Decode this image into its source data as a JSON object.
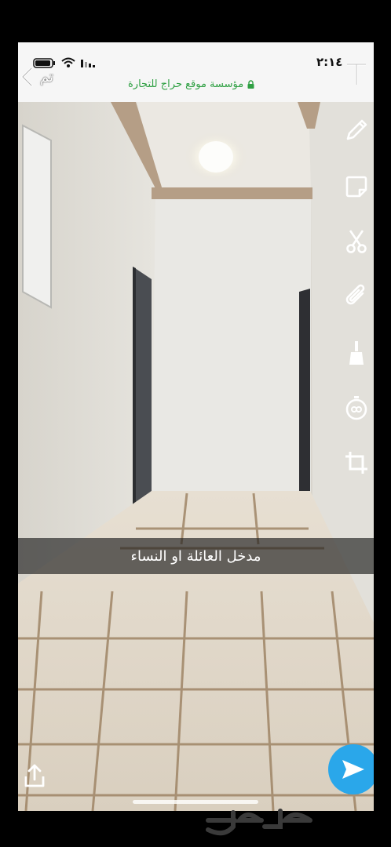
{
  "status_bar": {
    "time": "٢:١٤"
  },
  "header": {
    "back_label": "تم",
    "secure_url": "مؤسسة موقع حراج للتجارة"
  },
  "tools": [
    "text-icon",
    "pencil-icon",
    "sticker-icon",
    "scissors-icon",
    "paperclip-icon",
    "brush-icon",
    "timer-icon",
    "crop-icon"
  ],
  "caption": {
    "text": "مدخل العائلة او النساء"
  },
  "footer": {
    "watermark": "حراج"
  },
  "colors": {
    "accent": "#2aa7ea",
    "secure_green": "#2fa043"
  }
}
